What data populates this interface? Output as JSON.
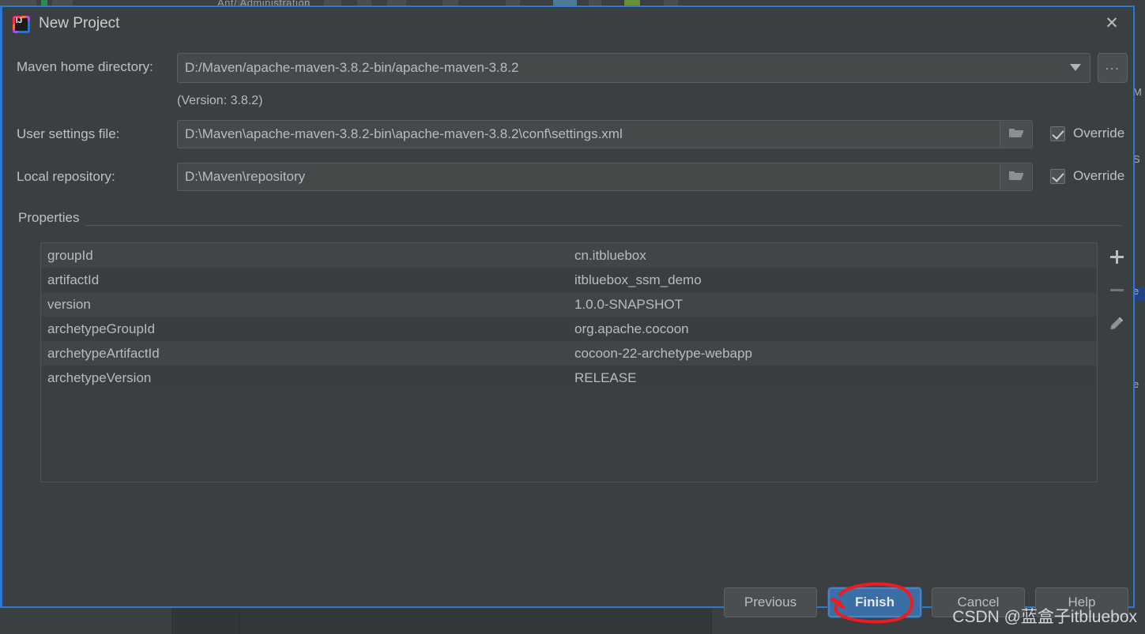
{
  "background": {
    "top_strip_text": "Ant/ Administration",
    "right_strip_text_1": "M",
    "right_strip_text_2": "S",
    "right_strip_text_3": "e",
    "right_strip_text_4": "e"
  },
  "window": {
    "title": "New Project",
    "logo_text": "IJ",
    "close_label": "✕"
  },
  "form": {
    "maven_home": {
      "label": "Maven home directory:",
      "value": "D:/Maven/apache-maven-3.8.2-bin/apache-maven-3.8.2",
      "dropdown_icon": "chevron-down-icon",
      "browse_label": "..."
    },
    "version_note": "(Version: 3.8.2)",
    "user_settings": {
      "label": "User settings file:",
      "value": "D:\\Maven\\apache-maven-3.8.2-bin\\apache-maven-3.8.2\\conf\\settings.xml",
      "browse_icon": "folder-open-icon",
      "override_label": "Override",
      "override_checked": true
    },
    "local_repository": {
      "label": "Local repository:",
      "value": "D:\\Maven\\repository",
      "browse_icon": "folder-open-icon",
      "override_label": "Override",
      "override_checked": true
    }
  },
  "properties": {
    "group_label": "Properties",
    "rows": [
      {
        "key": "groupId",
        "value": "cn.itbluebox"
      },
      {
        "key": "artifactId",
        "value": "itbluebox_ssm_demo"
      },
      {
        "key": "version",
        "value": "1.0.0-SNAPSHOT"
      },
      {
        "key": "archetypeGroupId",
        "value": "org.apache.cocoon"
      },
      {
        "key": "archetypeArtifactId",
        "value": "cocoon-22-archetype-webapp"
      },
      {
        "key": "archetypeVersion",
        "value": "RELEASE"
      }
    ],
    "toolbar": {
      "add_icon": "plus-icon",
      "remove_icon": "minus-icon",
      "edit_icon": "pencil-icon"
    }
  },
  "footer": {
    "previous_label": "Previous",
    "finish_label": "Finish",
    "cancel_label": "Cancel",
    "help_label": "Help"
  },
  "watermark": {
    "text": "CSDN @蓝盒子itbluebox"
  },
  "colors": {
    "dialog_bg": "#3c3f41",
    "dialog_border": "#2a7ad4",
    "field_bg": "#45494a",
    "text": "#b6bcc2",
    "primary_button": "#3a6ea5",
    "annotation_red": "#ee1c1c"
  }
}
